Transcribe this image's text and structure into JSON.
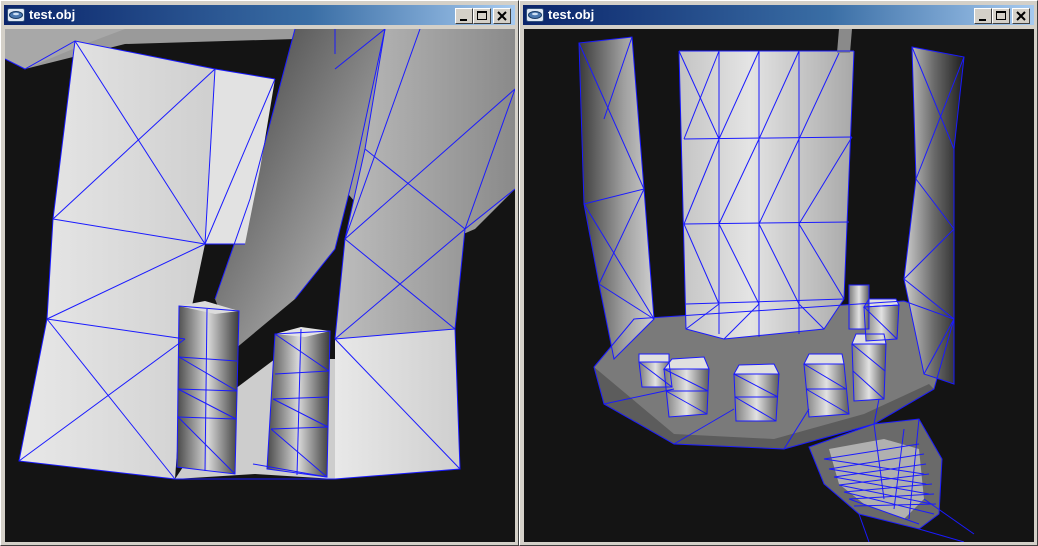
{
  "windows": [
    {
      "title": "test.obj",
      "icon": "app-icon",
      "controls": [
        "minimize-icon",
        "maximize-icon",
        "close-icon"
      ],
      "viewport": {
        "background": "#141414",
        "wireframe_color": "#1a1aff"
      }
    },
    {
      "title": "test.obj",
      "icon": "app-icon",
      "controls": [
        "minimize-icon",
        "maximize-icon",
        "close-icon"
      ],
      "viewport": {
        "background": "#141414",
        "wireframe_color": "#1a1aff"
      }
    }
  ],
  "colors": {
    "titlebar_start": "#0a246a",
    "titlebar_end": "#a6caf0",
    "window_face": "#d4d0c8"
  }
}
